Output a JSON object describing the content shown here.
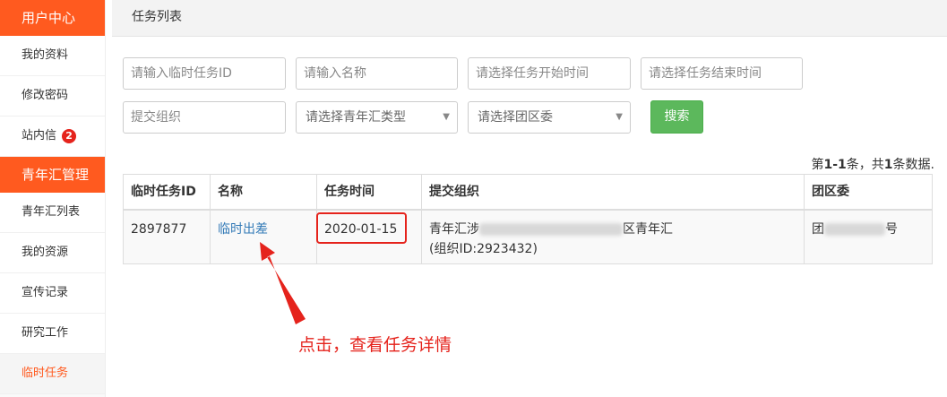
{
  "sidebar": {
    "section1": "用户中心",
    "items1": [
      {
        "label": "我的资料"
      },
      {
        "label": "修改密码"
      },
      {
        "label": "站内信",
        "badge": "2"
      }
    ],
    "section2": "青年汇管理",
    "items2": [
      {
        "label": "青年汇列表"
      },
      {
        "label": "我的资源"
      },
      {
        "label": "宣传记录"
      },
      {
        "label": "研究工作"
      },
      {
        "label": "临时任务"
      }
    ]
  },
  "header": {
    "title": "任务列表"
  },
  "filters": {
    "task_id_placeholder": "请输入临时任务ID",
    "name_placeholder": "请输入名称",
    "start_time_placeholder": "请选择任务开始时间",
    "end_time_placeholder": "请选择任务结束时间",
    "org_placeholder": "提交组织",
    "type_select": "请选择青年汇类型",
    "district_select": "请选择团区委",
    "search_label": "搜索"
  },
  "summary": {
    "prefix": "第",
    "range": "1-1",
    "mid": "条，共",
    "total": "1",
    "suffix": "条数据."
  },
  "table": {
    "headers": [
      "临时任务ID",
      "名称",
      "任务时间",
      "提交组织",
      "团区委"
    ],
    "rows": [
      {
        "id": "2897877",
        "name": "临时出差",
        "time": "2020-01-15",
        "org_start": "青年汇涉",
        "org_end": "区青年汇",
        "org_id": "(组织ID:2923432)",
        "district_start": "团",
        "district_end": "号"
      }
    ]
  },
  "annotation": {
    "text": "点击，查看任务详情",
    "color": "#e5231c"
  },
  "colors": {
    "brand": "#ff5a1f",
    "search_button": "#5cb85c",
    "link": "#337ab7"
  }
}
